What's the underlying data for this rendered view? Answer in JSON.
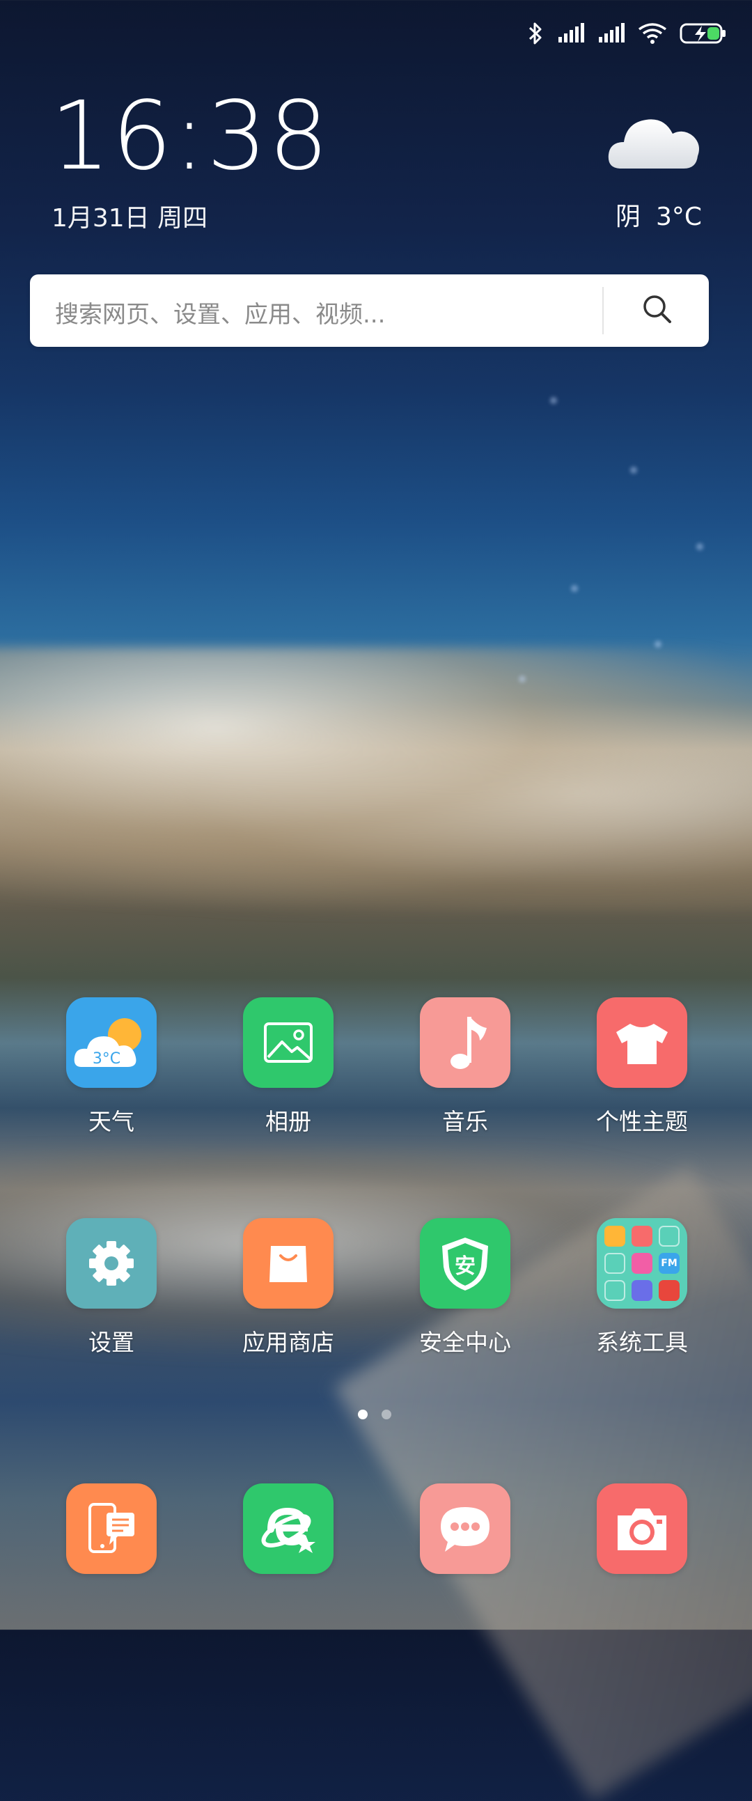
{
  "status_bar": {
    "icons": [
      "bluetooth-icon",
      "signal-icon",
      "signal-icon",
      "wifi-icon",
      "battery-charging-icon"
    ]
  },
  "clock": {
    "time": "16:38",
    "date": "1月31日 周四"
  },
  "weather_widget": {
    "icon": "cloud-icon",
    "condition": "阴",
    "temperature": "3°C"
  },
  "search": {
    "placeholder": "搜索网页、设置、应用、视频...",
    "icon": "search-icon"
  },
  "apps_row1": [
    {
      "label": "天气",
      "icon": "weather-icon",
      "icon_text": "3°C",
      "color": "#3aa5ea"
    },
    {
      "label": "相册",
      "icon": "gallery-icon",
      "color": "#2fc86c"
    },
    {
      "label": "音乐",
      "icon": "music-icon",
      "color": "#f79a96"
    },
    {
      "label": "个性主题",
      "icon": "theme-icon",
      "color": "#f76b6b"
    }
  ],
  "apps_row2": [
    {
      "label": "设置",
      "icon": "settings-icon",
      "color": "#5fb0b8"
    },
    {
      "label": "应用商店",
      "icon": "app-store-icon",
      "color": "#ff8a4f"
    },
    {
      "label": "安全中心",
      "icon": "security-icon",
      "icon_text": "安",
      "color": "#2fc86c"
    },
    {
      "label": "系统工具",
      "icon": "folder-icon",
      "folder_text": "FM",
      "color": "#5ad0b8"
    }
  ],
  "page_indicator": {
    "pages": 2,
    "current": 1
  },
  "dock": [
    {
      "icon": "phone-icon",
      "color": "#ff8a4f"
    },
    {
      "icon": "browser-icon",
      "color": "#2fc86c"
    },
    {
      "icon": "messages-icon",
      "color": "#f79a96"
    },
    {
      "icon": "camera-icon",
      "color": "#f76b6b"
    }
  ]
}
